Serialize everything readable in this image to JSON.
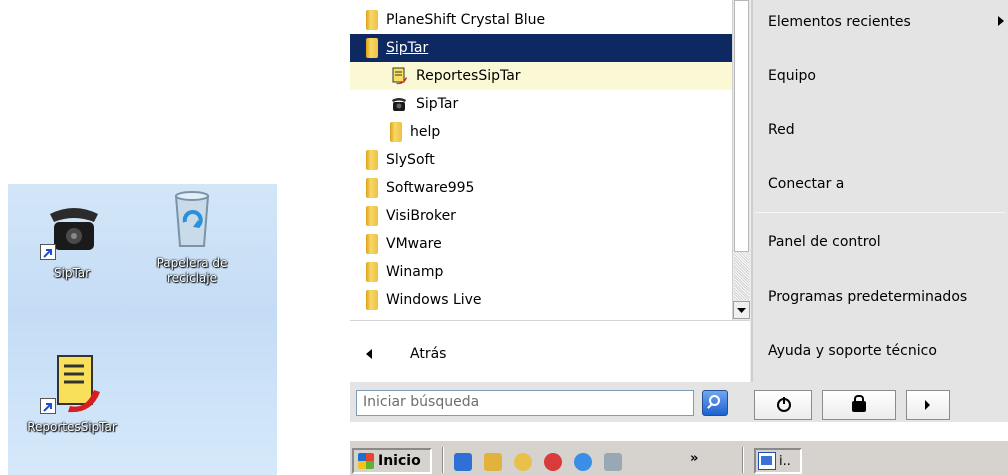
{
  "desktop": {
    "icons": [
      {
        "label": "SipTar"
      },
      {
        "label": "Papelera de reciclaje"
      },
      {
        "label": "ReportesSipTar"
      }
    ]
  },
  "start_menu": {
    "programs": [
      {
        "label": "PlaneShift Crystal Blue",
        "icon": "folder-icon"
      },
      {
        "label": "SipTar",
        "icon": "folder-icon",
        "selected": true
      },
      {
        "label": "ReportesSipTar",
        "icon": "report-icon",
        "highlighted": true
      },
      {
        "label": "SipTar",
        "icon": "phone-icon"
      },
      {
        "label": "help",
        "icon": "folder-icon"
      },
      {
        "label": "SlySoft",
        "icon": "folder-icon"
      },
      {
        "label": "Software995",
        "icon": "folder-icon"
      },
      {
        "label": "VisiBroker",
        "icon": "folder-icon"
      },
      {
        "label": "VMware",
        "icon": "folder-icon"
      },
      {
        "label": "Winamp",
        "icon": "folder-icon"
      },
      {
        "label": "Windows Live",
        "icon": "folder-icon"
      }
    ],
    "back_label": "Atrás",
    "right_items": [
      {
        "label": "Elementos recientes"
      },
      {
        "label": "Equipo"
      },
      {
        "label": "Red"
      },
      {
        "label": "Conectar a"
      },
      {
        "label": "Panel de control"
      },
      {
        "label": "Programas predeterminados"
      },
      {
        "label": "Ayuda y soporte técnico"
      }
    ],
    "search_placeholder": "Iniciar búsqueda"
  },
  "taskbar": {
    "start_label": "Inicio",
    "overflow_label": "»",
    "task_label": "i.."
  },
  "colors": {
    "selected": "#0e2961",
    "highlight": "#fbf8d6",
    "right_panel": "#e4e4e4"
  }
}
